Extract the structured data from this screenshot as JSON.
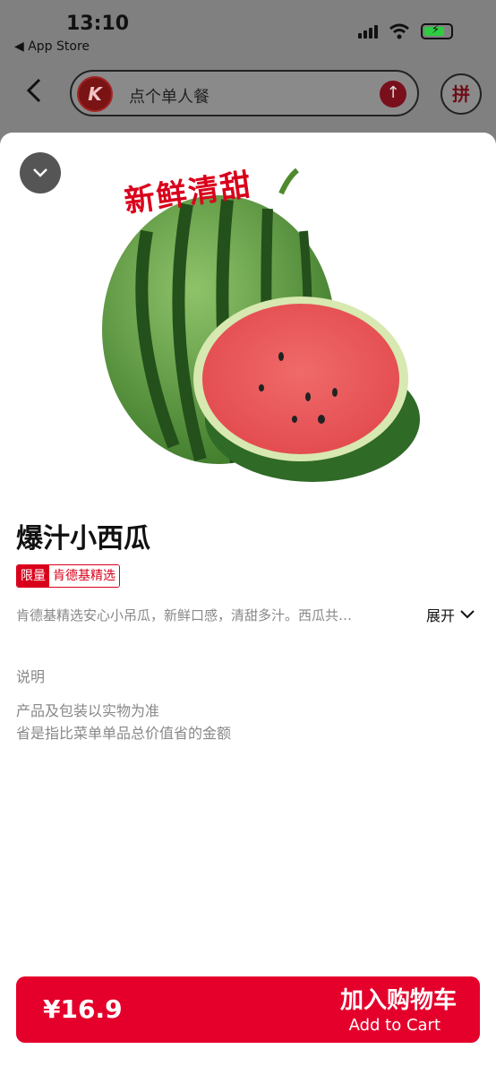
{
  "status_bar": {
    "time": "13:10",
    "back_app_label": "◀ App Store",
    "battery_charging": true
  },
  "header": {
    "back_icon": "chevron-left-icon",
    "search_placeholder": "点个单人餐",
    "search_logo_text": "K",
    "group_button_label": "拼"
  },
  "modal": {
    "close_icon": "chevron-down-icon",
    "image_headline": "新鲜清甜",
    "product_title": "爆汁小西瓜",
    "tag_primary": "限量",
    "tag_secondary": "肯德基精选",
    "description": "肯德基精选安心小吊瓜，新鲜口感，清甜多汁。西瓜共…",
    "expand_label": "展开",
    "notes_title": "说明",
    "notes": [
      "产品及包装以实物为准",
      "省是指比菜单单品总价值省的金额"
    ]
  },
  "cta": {
    "price": "¥16.9",
    "label_cn": "加入购物车",
    "label_en": "Add to Cart",
    "color": "#e4002b"
  },
  "colors": {
    "brand_red": "#d9001b",
    "overlay_gray": "#808080"
  }
}
